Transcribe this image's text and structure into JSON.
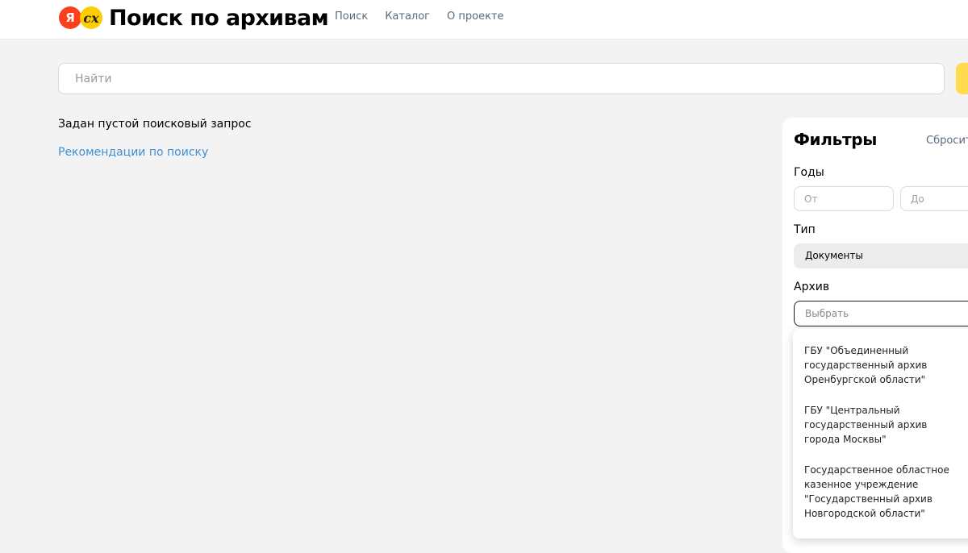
{
  "header": {
    "logo": {
      "ya_glyph": "Я",
      "cx_glyph": "cx",
      "title": "Поиск по архивам"
    },
    "nav": [
      "Поиск",
      "Каталог",
      "О проекте"
    ]
  },
  "search": {
    "placeholder": "Найти",
    "value": ""
  },
  "results": {
    "empty_message": "Задан пустой поисковый запрос",
    "recommendations_link": "Рекомендации по поиску"
  },
  "filters": {
    "title": "Фильтры",
    "reset_label": "Сбросить",
    "years": {
      "label": "Годы",
      "from_placeholder": "От",
      "to_placeholder": "До"
    },
    "type": {
      "label": "Тип",
      "selected": "Документы"
    },
    "archive": {
      "label": "Архив",
      "placeholder": "Выбрать",
      "options": [
        "ГБУ \"Объединенный государственный архив Оренбургской области\"",
        "ГБУ \"Центральный государственный архив города Москвы\"",
        "Государственное областное казенное учреждение \"Государственный архив Новгородской области\""
      ]
    }
  },
  "colors": {
    "accent": "#ffdb4d",
    "link": "#3d8fd6",
    "nav_text": "#5b6a7d",
    "logo_red": "#fc3f1d",
    "logo_yellow": "#ffcc00"
  }
}
